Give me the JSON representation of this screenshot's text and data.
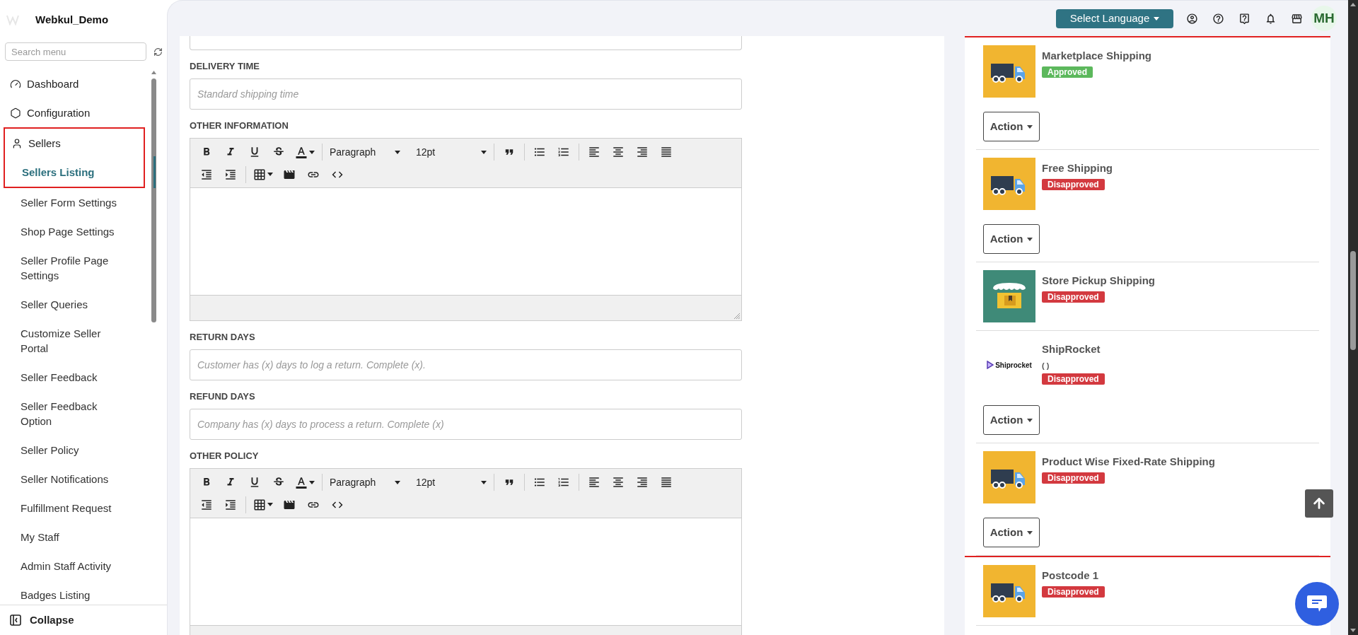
{
  "sidebar": {
    "brand": "Webkul_Demo",
    "search": {
      "placeholder": "Search menu"
    },
    "items": [
      {
        "label": "Dashboard"
      },
      {
        "label": "Configuration"
      },
      {
        "label": "Sellers",
        "highlighted": true,
        "children": [
          {
            "label": "Sellers Listing",
            "selected": true
          },
          {
            "label": "Seller Form Settings",
            "selected": false
          },
          {
            "label": "Shop Page Settings",
            "selected": false
          },
          {
            "label": "Seller Profile Page Settings",
            "selected": false
          },
          {
            "label": "Seller Queries",
            "selected": false
          },
          {
            "label": "Customize Seller Portal",
            "selected": false
          },
          {
            "label": "Seller Feedback",
            "selected": false
          },
          {
            "label": "Seller Feedback Option",
            "selected": false
          },
          {
            "label": "Seller Policy",
            "selected": false
          },
          {
            "label": "Seller Notifications",
            "selected": false
          },
          {
            "label": "Fulfillment Request",
            "selected": false
          },
          {
            "label": "My Staff",
            "selected": false
          },
          {
            "label": "Admin Staff Activity",
            "selected": false
          },
          {
            "label": "Badges Listing",
            "selected": false
          }
        ]
      }
    ],
    "collapse": "Collapse"
  },
  "top_bar": {
    "language": "Select Language",
    "avatar": "MH"
  },
  "form": [
    {
      "kind": "input",
      "label": "DELIVERY TIME",
      "placeholder": "Standard shipping time"
    },
    {
      "kind": "editor",
      "label": "OTHER INFORMATION",
      "block": "Paragraph",
      "size": "12pt"
    },
    {
      "kind": "input",
      "label": "RETURN DAYS",
      "placeholder": "Customer has (x) days to log a return. Complete (x)."
    },
    {
      "kind": "input",
      "label": "REFUND DAYS",
      "placeholder": "Company has (x) days to process a return. Complete (x)"
    },
    {
      "kind": "editor",
      "label": "OTHER POLICY",
      "block": "Paragraph",
      "size": "12pt"
    }
  ],
  "shipping_groups": [
    {
      "highlighted": true,
      "methods": [
        {
          "kind": "truck",
          "name": "Marketplace Shipping",
          "status": "Approved",
          "approved": true,
          "action": "Action"
        },
        {
          "kind": "truck",
          "name": "Free Shipping",
          "status": "Disapproved",
          "approved": false,
          "action": "Action"
        },
        {
          "kind": "store",
          "name": "Store Pickup Shipping",
          "status": "Disapproved",
          "approved": false
        },
        {
          "kind": "logo",
          "logo_text": "Shiprocket",
          "name": "ShipRocket",
          "note": "( )",
          "status": "Disapproved",
          "approved": false,
          "action": "Action"
        },
        {
          "kind": "truck",
          "name": "Product Wise Fixed-Rate Shipping",
          "status": "Disapproved",
          "approved": false,
          "action": "Action"
        }
      ]
    },
    {
      "highlighted": false,
      "methods": [
        {
          "kind": "truck",
          "name": "Postcode 1",
          "status": "Disapproved",
          "approved": false
        }
      ]
    }
  ]
}
